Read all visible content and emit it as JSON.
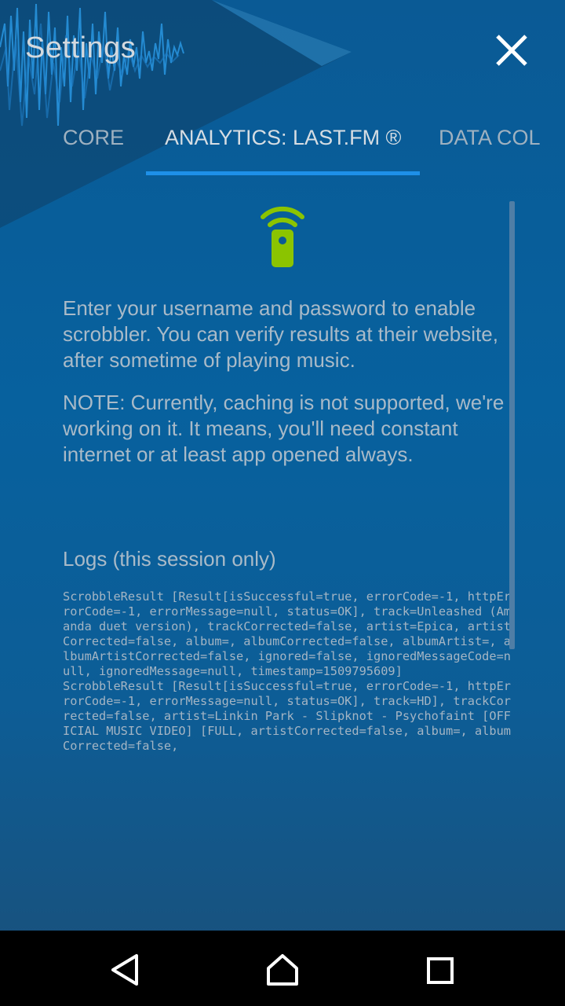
{
  "header": {
    "title": "Settings",
    "close_icon": "close-icon"
  },
  "tabs": [
    {
      "label": "CORE",
      "active": false
    },
    {
      "label": "ANALYTICS: LAST.FM ®",
      "active": true
    },
    {
      "label": "DATA COL",
      "active": false
    }
  ],
  "colors": {
    "background": "#0a5a95",
    "accent": "#1e90e8",
    "icon_green": "#8bc400",
    "text": "#a9bac8"
  },
  "content": {
    "icon": "remote-signal-icon",
    "paragraph1": "Enter your username and password to enable scrobbler. You can verify results at their website, after sometime of playing music.",
    "paragraph2": "NOTE: Currently, caching is not supported, we're working on it. It means, you'll need constant internet or at least app opened always.",
    "logs_title": "Logs (this session only)",
    "logs": [
      "ScrobbleResult [Result[isSuccessful=true, errorCode=-1, httpErrorCode=-1, errorMessage=null, status=OK], track=Unleashed (Amanda duet version), trackCorrected=false, artist=Epica, artistCorrected=false, album=, albumCorrected=false, albumArtist=, albumArtistCorrected=false, ignored=false, ignoredMessageCode=null, ignoredMessage=null, timestamp=1509795609]",
      "ScrobbleResult [Result[isSuccessful=true, errorCode=-1, httpErrorCode=-1, errorMessage=null, status=OK], track=HD], trackCorrected=false, artist=Linkin Park - Slipknot - Psychofaint [OFFICIAL MUSIC VIDEO] [FULL, artistCorrected=false, album=, albumCorrected=false,"
    ]
  },
  "navbar": {
    "back_icon": "back-icon",
    "home_icon": "home-icon",
    "recents_icon": "recents-icon"
  }
}
